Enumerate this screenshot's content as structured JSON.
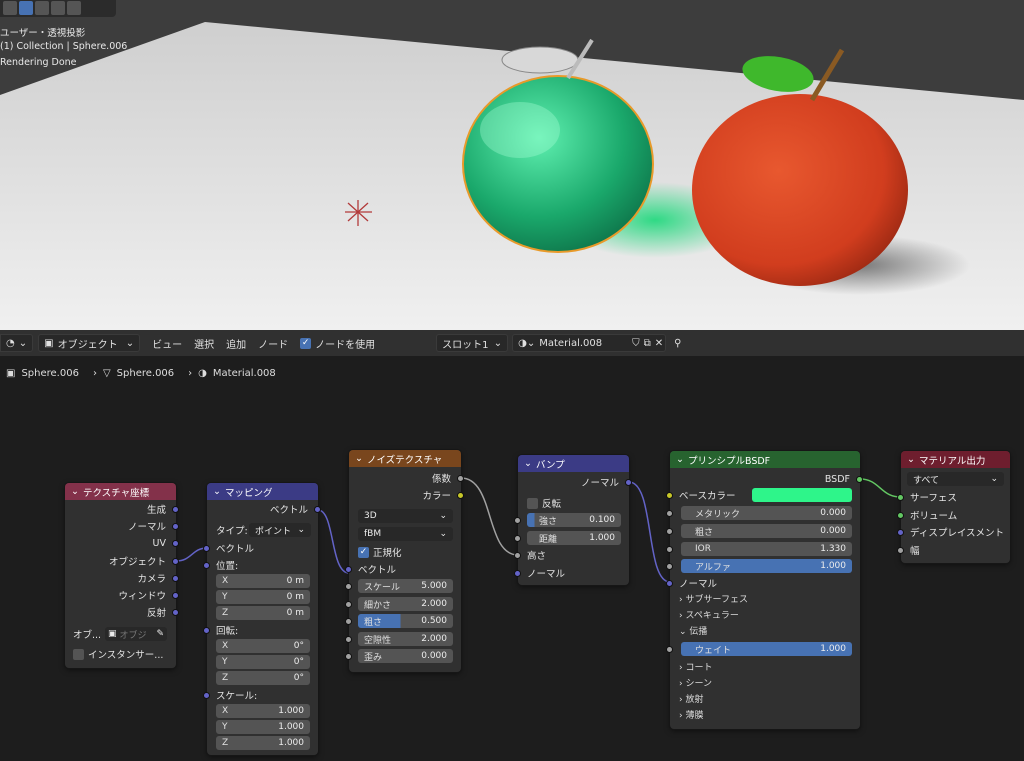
{
  "viewport": {
    "info_lines": [
      "ユーザー・透視投影",
      "(1) Collection | Sphere.006",
      "Rendering Done"
    ]
  },
  "header": {
    "mode": "オブジェクト",
    "menus": [
      "ビュー",
      "選択",
      "追加",
      "ノード"
    ],
    "use_nodes_label": "ノードを使用",
    "slot": "スロット1",
    "material": "Material.008"
  },
  "breadcrumb": [
    "Sphere.006",
    "Sphere.006",
    "Material.008"
  ],
  "nodes": {
    "texcoord": {
      "title": "テクスチャ座標",
      "outputs": [
        "生成",
        "ノーマル",
        "UV",
        "オブジェクト",
        "カメラ",
        "ウィンドウ",
        "反射"
      ],
      "object_label": "オブ...",
      "object_placeholder": "オブジ",
      "instancer_label": "インスタンサー..."
    },
    "mapping": {
      "title": "マッピング",
      "output": "ベクトル",
      "type_label": "タイプ:",
      "type_value": "ポイント",
      "vector_label": "ベクトル",
      "location_label": "位置:",
      "location": [
        {
          "a": "X",
          "v": "0 m"
        },
        {
          "a": "Y",
          "v": "0 m"
        },
        {
          "a": "Z",
          "v": "0 m"
        }
      ],
      "rotation_label": "回転:",
      "rotation": [
        {
          "a": "X",
          "v": "0°"
        },
        {
          "a": "Y",
          "v": "0°"
        },
        {
          "a": "Z",
          "v": "0°"
        }
      ],
      "scale_label": "スケール:",
      "scale": [
        {
          "a": "X",
          "v": "1.000"
        },
        {
          "a": "Y",
          "v": "1.000"
        },
        {
          "a": "Z",
          "v": "1.000"
        }
      ]
    },
    "noise": {
      "title": "ノイズテクスチャ",
      "out_fac": "係数",
      "out_color": "カラー",
      "dim": "3D",
      "type": "fBM",
      "normalize_label": "正規化",
      "vector_label": "ベクトル",
      "fields": [
        {
          "label": "スケール",
          "value": "5.000"
        },
        {
          "label": "細かさ",
          "value": "2.000"
        },
        {
          "label": "粗さ",
          "value": "0.500"
        },
        {
          "label": "空隙性",
          "value": "2.000"
        },
        {
          "label": "歪み",
          "value": "0.000"
        }
      ]
    },
    "bump": {
      "title": "バンプ",
      "out_normal": "ノーマル",
      "invert_label": "反転",
      "strength_label": "強さ",
      "strength_value": "0.100",
      "distance_label": "距離",
      "distance_value": "1.000",
      "height_label": "高さ",
      "normal_label": "ノーマル"
    },
    "bsdf": {
      "title": "プリンシプルBSDF",
      "out": "BSDF",
      "base_color_label": "ベースカラー",
      "base_color": "#2ef58a",
      "fields": [
        {
          "label": "メタリック",
          "value": "0.000"
        },
        {
          "label": "粗さ",
          "value": "0.000"
        },
        {
          "label": "IOR",
          "value": "1.330"
        },
        {
          "label": "アルファ",
          "value": "1.000"
        }
      ],
      "normal_label": "ノーマル",
      "subsurface": "サブサーフェス",
      "specular": "スペキュラー",
      "transmission": "伝播",
      "weight_label": "ウェイト",
      "weight_value": "1.000",
      "coat": "コート",
      "sheen": "シーン",
      "emission": "放射",
      "thin_film": "薄膜"
    },
    "output": {
      "title": "マテリアル出力",
      "target": "すべて",
      "inputs": [
        "サーフェス",
        "ボリューム",
        "ディスプレイスメント",
        "幅"
      ]
    }
  },
  "colors": {
    "texcoord_header": "#83314a",
    "vector_header": "#3b3b85",
    "texture_header": "#79461d",
    "shader_header": "#27632f",
    "output_header": "#6e1e2e",
    "accent": "#4772b3"
  }
}
